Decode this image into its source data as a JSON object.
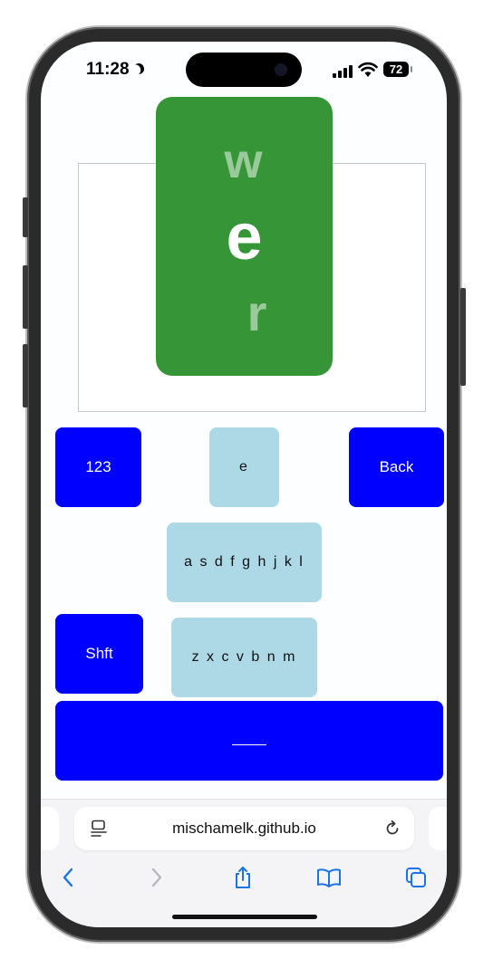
{
  "status_bar": {
    "time": "11:28",
    "battery": "72"
  },
  "preview": {
    "previous_letter": "w",
    "current_letter": "e",
    "next_letter": "r"
  },
  "keys": {
    "numbers": "123",
    "current_letter_key": "e",
    "back": "Back",
    "row_middle": "a s d f g h j k l",
    "shift": "Shft",
    "row_bottom": "z x c v b n m"
  },
  "browser": {
    "url": "mischamelk.github.io"
  },
  "colors": {
    "blue_key": "#0000ff",
    "light_key": "#add8e6",
    "letter_card": "#359537"
  }
}
